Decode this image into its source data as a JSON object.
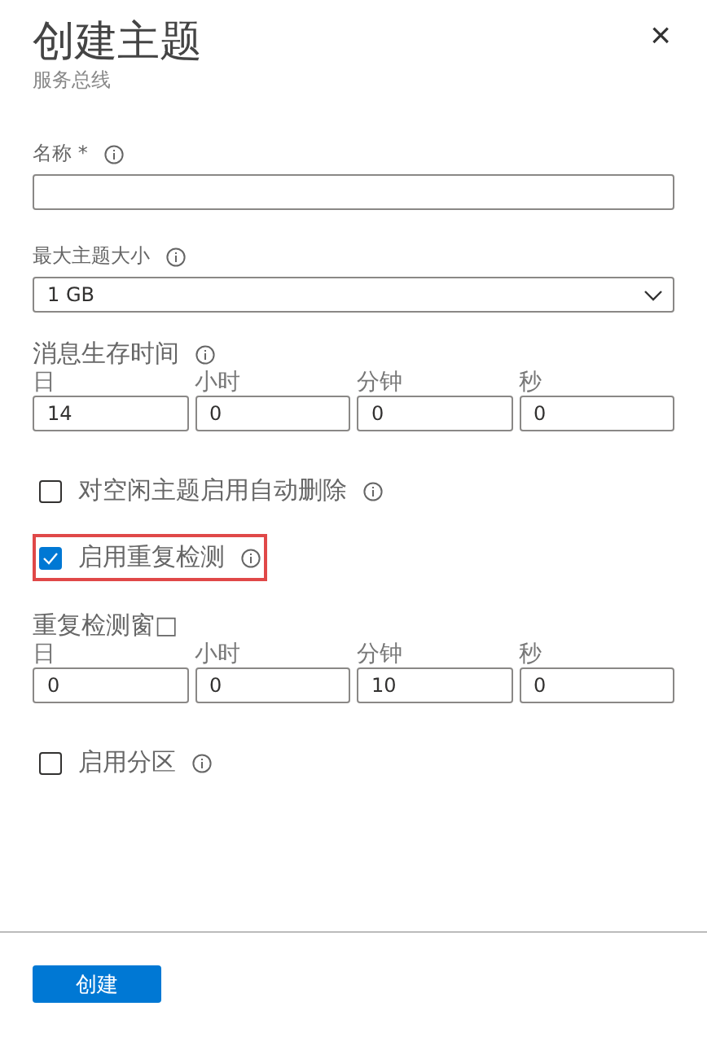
{
  "header": {
    "title": "创建主题",
    "subtitle": "服务总线",
    "close": "×"
  },
  "name_field": {
    "label": "名称 *"
  },
  "max_size": {
    "label": "最大主题大小",
    "value": "1 GB"
  },
  "message_ttl": {
    "label": "消息生存时间",
    "units": [
      {
        "label": "日",
        "value": "14"
      },
      {
        "label": "小时",
        "value": "0"
      },
      {
        "label": "分钟",
        "value": "0"
      },
      {
        "label": "秒",
        "value": "0"
      }
    ]
  },
  "options": [
    {
      "label": "对空闲主题启用自动删除",
      "checked": false,
      "highlighted": false
    },
    {
      "label": "启用重复检测",
      "checked": true,
      "highlighted": true
    }
  ],
  "duplicate_window": {
    "label": "重复检测窗□",
    "units": [
      {
        "label": "日",
        "value": "0"
      },
      {
        "label": "小时",
        "value": "0"
      },
      {
        "label": "分钟",
        "value": "10"
      },
      {
        "label": "秒",
        "value": "0"
      }
    ]
  },
  "partitioning": {
    "label": "启用分区",
    "checked": false
  },
  "footer": {
    "button": "创建"
  }
}
